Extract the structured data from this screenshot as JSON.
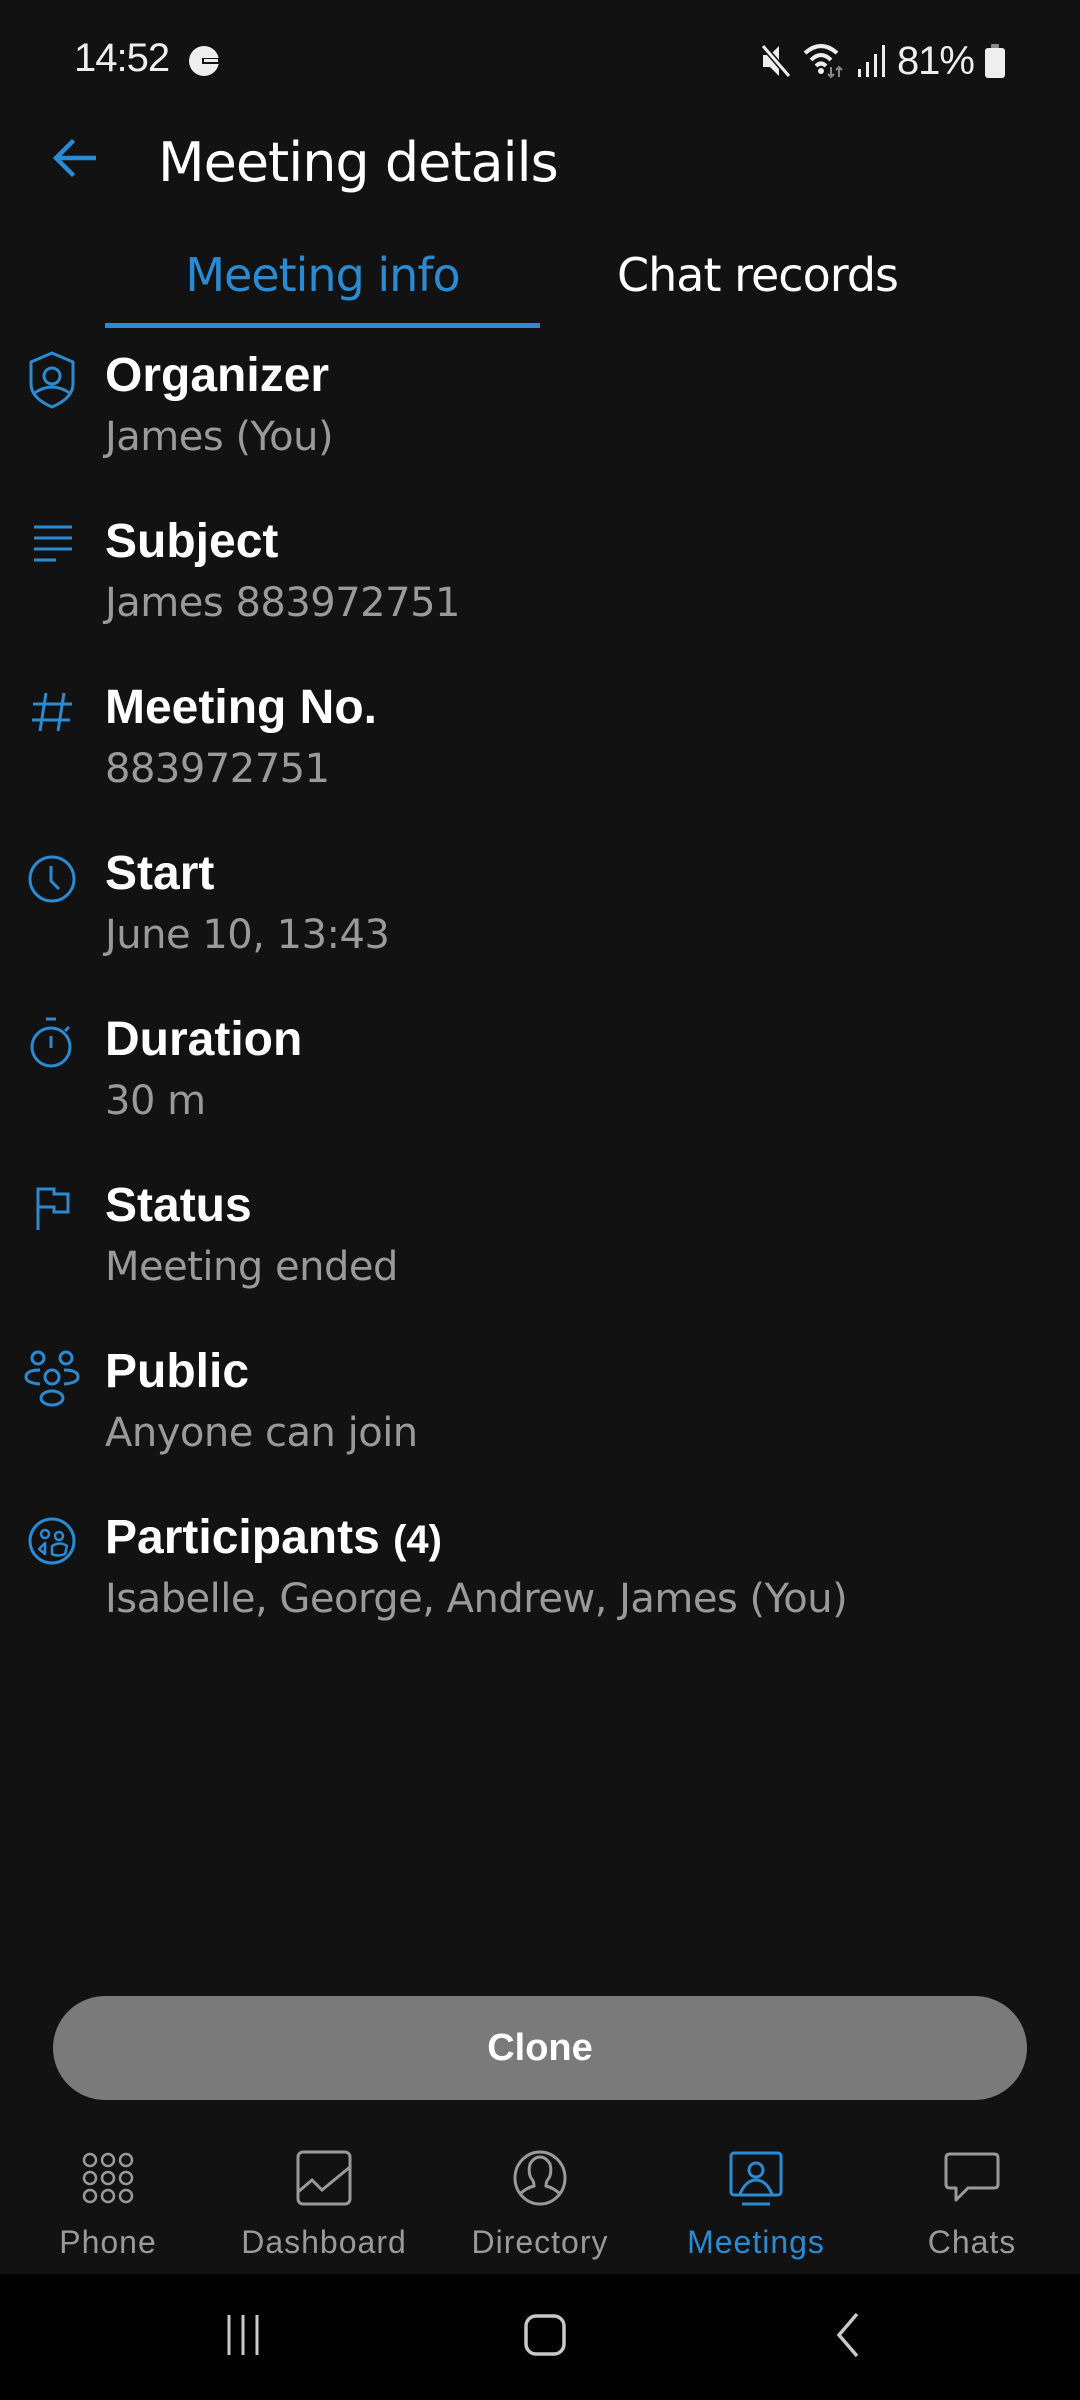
{
  "status_bar": {
    "time": "14:52",
    "battery": "81%"
  },
  "header": {
    "title": "Meeting details",
    "back_icon": "arrow-left-icon"
  },
  "tabs": [
    {
      "label": "Meeting info",
      "active": true
    },
    {
      "label": "Chat records",
      "active": false
    }
  ],
  "details": {
    "organizer": {
      "label": "Organizer",
      "value": "James (You)",
      "icon": "shield-user-icon"
    },
    "subject": {
      "label": "Subject",
      "value": "James 883972751",
      "icon": "text-lines-icon"
    },
    "meeting_no": {
      "label": "Meeting No.",
      "value": "883972751",
      "icon": "hash-icon"
    },
    "start": {
      "label": "Start",
      "value": "June 10, 13:43",
      "icon": "clock-icon"
    },
    "duration": {
      "label": "Duration",
      "value": "30 m",
      "icon": "stopwatch-icon"
    },
    "status": {
      "label": "Status",
      "value": "Meeting ended",
      "icon": "flag-icon"
    },
    "public": {
      "label": "Public",
      "value": "Anyone can join",
      "icon": "group-icon"
    },
    "participants": {
      "label": "Participants",
      "count": "(4)",
      "value": "Isabelle, George, Andrew, James (You)",
      "icon": "participants-icon"
    }
  },
  "actions": {
    "clone_label": "Clone"
  },
  "bottom_nav": [
    {
      "label": "Phone",
      "icon": "dialpad-icon",
      "active": false
    },
    {
      "label": "Dashboard",
      "icon": "chart-icon",
      "active": false
    },
    {
      "label": "Directory",
      "icon": "contact-icon",
      "active": false
    },
    {
      "label": "Meetings",
      "icon": "meeting-icon",
      "active": true
    },
    {
      "label": "Chats",
      "icon": "chat-bubble-icon",
      "active": false
    }
  ],
  "colors": {
    "accent": "#2a8ad2",
    "background": "#121212",
    "secondary_text": "#9a9a9a",
    "button_bg": "#7a7a7a"
  }
}
